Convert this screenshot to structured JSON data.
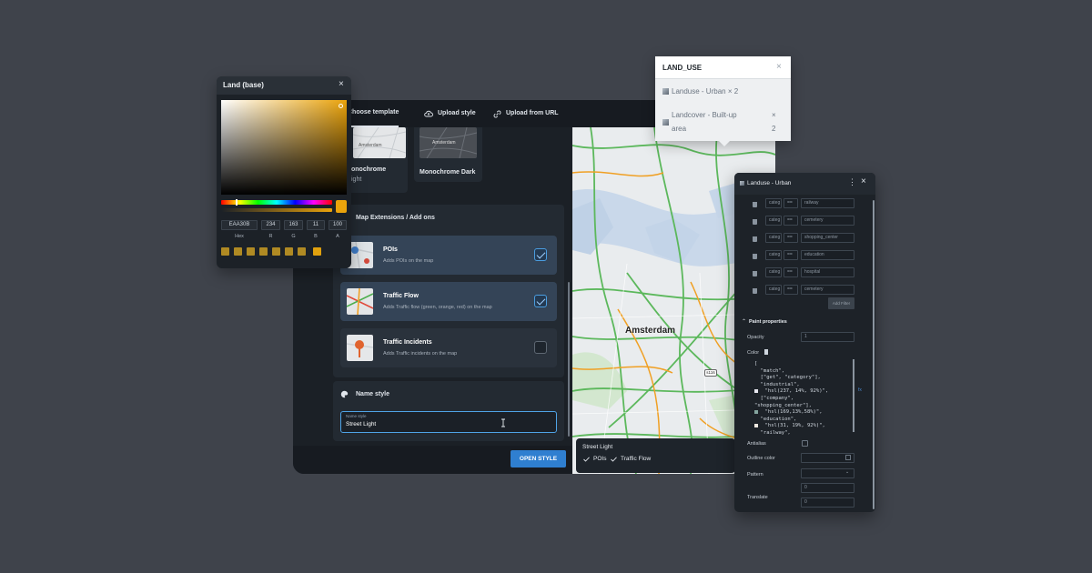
{
  "main": {
    "tabs": [
      {
        "label": "Choose template"
      },
      {
        "label": "Upload style"
      },
      {
        "label": "Upload from URL"
      }
    ],
    "templates": {
      "light_label_1": "onochrome",
      "light_label_2": "ight",
      "dark_label": "Monochrome Dark",
      "light_thumb_text": "Amsterdam",
      "dark_thumb_text": "Amsterdam"
    },
    "extensions": {
      "title": "Map Extensions / Add ons",
      "items": [
        {
          "title": "POIs",
          "desc": "Adds POIs on the map",
          "checked": true
        },
        {
          "title": "Traffic Flow",
          "desc": "Adds Traffic flow (green, orange, red) on the map",
          "checked": true
        },
        {
          "title": "Traffic Incidents",
          "desc": "Adds Traffic incidents on the map",
          "checked": false
        }
      ]
    },
    "name_style": {
      "title": "Name style",
      "field_label": "Name style",
      "value": "Street Light"
    },
    "open_button": "OPEN STYLE",
    "map": {
      "city_label": "Amsterdam",
      "road_shield": "s116",
      "style_name": "Street Light",
      "badges": [
        "POIs",
        "Traffic Flow"
      ]
    }
  },
  "picker": {
    "title": "Land (base)",
    "hex": "EAA30B",
    "r": "234",
    "g": "163",
    "b": "11",
    "a": "100",
    "labels": [
      "Hex",
      "R",
      "G",
      "B",
      "A"
    ],
    "color": "#eaa30b"
  },
  "land_use": {
    "title": "LAND_USE",
    "items": [
      {
        "name": "Landuse - Urban × 2"
      },
      {
        "name_1": "Landcover - Built-up",
        "name_2": "area",
        "count_1": "×",
        "count_2": "2"
      }
    ]
  },
  "panel": {
    "title": "Landuse - Urban",
    "filters": [
      {
        "op1": "categ",
        "op2": "==",
        "value": "railway"
      },
      {
        "op1": "categ",
        "op2": "==",
        "value": "cemetery"
      },
      {
        "op1": "categ",
        "op2": "==",
        "value": "shopping_center"
      },
      {
        "op1": "categ",
        "op2": "==",
        "value": "education"
      },
      {
        "op1": "categ",
        "op2": "==",
        "value": "hospital"
      },
      {
        "op1": "categ",
        "op2": "==",
        "value": "cemetery"
      }
    ],
    "add_filter": "Add Filter",
    "paint_title": "Paint properties",
    "opacity_label": "Opacity",
    "opacity_value": "1",
    "color_label": "Color",
    "code_lines": [
      "[",
      "  \"match\",",
      "  [\"get\", \"category\"],",
      "  \"industrial\",",
      "  \"hsl(237, 14%, 92%)\",",
      "  [\"company\",",
      "\"shopping_center\"],",
      "  \"hsl(169,13%,58%)\",",
      "  \"education\",",
      "  \"hsl(31, 19%, 92%)\",",
      "  \"railway\","
    ],
    "antialias_label": "Antialias",
    "outline_label": "Outline color",
    "pattern_label": "Pattern",
    "translate_label": "Translate",
    "translate_x": "0",
    "translate_y": "0",
    "side_tag": "fx"
  }
}
